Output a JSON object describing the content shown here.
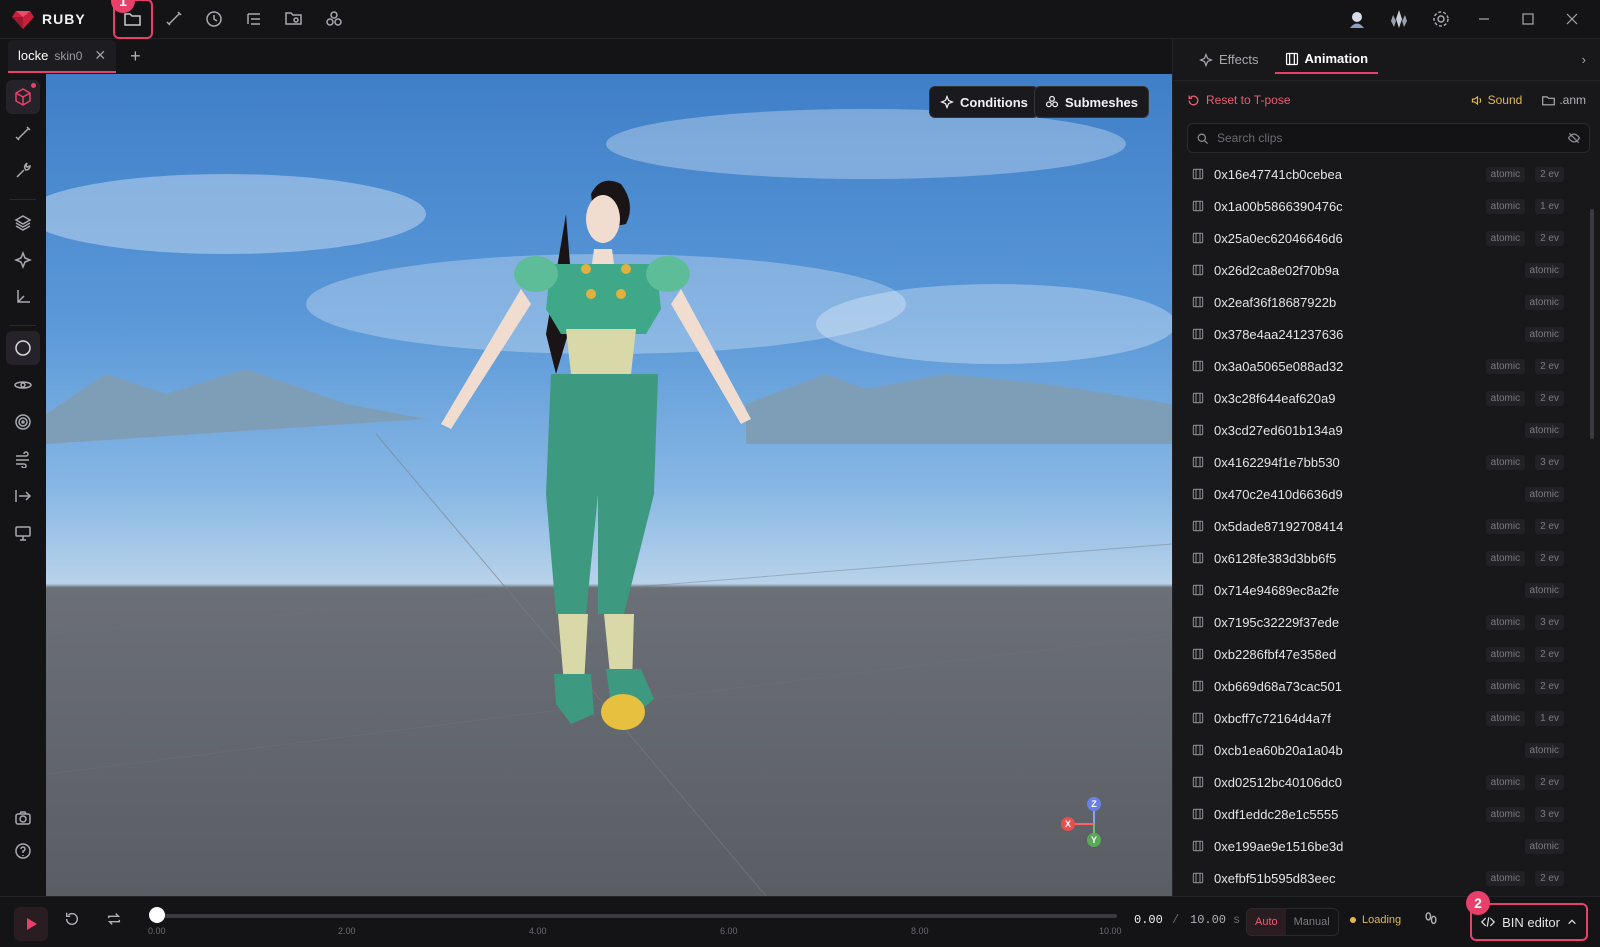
{
  "app": {
    "name": "RUBY"
  },
  "annotations": {
    "marker_1": "1",
    "marker_2": "2"
  },
  "tab": {
    "name": "locke",
    "sub": "skin0"
  },
  "viewport": {
    "conditions_label": "Conditions",
    "submeshes_label": "Submeshes",
    "axis": {
      "x": "X",
      "y": "Y",
      "z": "Z"
    }
  },
  "right_panel": {
    "tabs": [
      {
        "label": "Effects"
      },
      {
        "label": "Animation"
      }
    ],
    "reset_label": "Reset to T-pose",
    "sound_label": "Sound",
    "anm_label": ".anm",
    "search_placeholder": "Search clips",
    "clips": [
      {
        "name": "0x16e47741cb0cebea",
        "tag": "atomic",
        "events": "2 ev"
      },
      {
        "name": "0x1a00b5866390476c",
        "tag": "atomic",
        "events": "1 ev"
      },
      {
        "name": "0x25a0ec62046646d6",
        "tag": "atomic",
        "events": "2 ev"
      },
      {
        "name": "0x26d2ca8e02f70b9a",
        "tag": "atomic",
        "events": ""
      },
      {
        "name": "0x2eaf36f18687922b",
        "tag": "atomic",
        "events": ""
      },
      {
        "name": "0x378e4aa241237636",
        "tag": "atomic",
        "events": ""
      },
      {
        "name": "0x3a0a5065e088ad32",
        "tag": "atomic",
        "events": "2 ev"
      },
      {
        "name": "0x3c28f644eaf620a9",
        "tag": "atomic",
        "events": "2 ev"
      },
      {
        "name": "0x3cd27ed601b134a9",
        "tag": "atomic",
        "events": ""
      },
      {
        "name": "0x4162294f1e7bb530",
        "tag": "atomic",
        "events": "3 ev"
      },
      {
        "name": "0x470c2e410d6636d9",
        "tag": "atomic",
        "events": ""
      },
      {
        "name": "0x5dade87192708414",
        "tag": "atomic",
        "events": "2 ev"
      },
      {
        "name": "0x6128fe383d3bb6f5",
        "tag": "atomic",
        "events": "2 ev"
      },
      {
        "name": "0x714e94689ec8a2fe",
        "tag": "atomic",
        "events": ""
      },
      {
        "name": "0x7195c32229f37ede",
        "tag": "atomic",
        "events": "3 ev"
      },
      {
        "name": "0xb2286fbf47e358ed",
        "tag": "atomic",
        "events": "2 ev"
      },
      {
        "name": "0xb669d68a73cac501",
        "tag": "atomic",
        "events": "2 ev"
      },
      {
        "name": "0xbcff7c72164d4a7f",
        "tag": "atomic",
        "events": "1 ev"
      },
      {
        "name": "0xcb1ea60b20a1a04b",
        "tag": "atomic",
        "events": ""
      },
      {
        "name": "0xd02512bc40106dc0",
        "tag": "atomic",
        "events": "2 ev"
      },
      {
        "name": "0xdf1eddc28e1c5555",
        "tag": "atomic",
        "events": "3 ev"
      },
      {
        "name": "0xe199ae9e1516be3d",
        "tag": "atomic",
        "events": ""
      },
      {
        "name": "0xefbf51b595d83eec",
        "tag": "atomic",
        "events": "2 ev"
      }
    ]
  },
  "timeline": {
    "ticks": [
      "0.00",
      "2.00",
      "4.00",
      "6.00",
      "8.00",
      "10.00"
    ],
    "current_time": "0.00",
    "separator": "/",
    "total_time": "10.00",
    "unit": "s",
    "playhead_fraction": 0,
    "mode_auto": "Auto",
    "mode_manual": "Manual",
    "status": "Loading",
    "bin_editor_label": "BIN editor"
  },
  "colors": {
    "accent": "#e8406a",
    "warning": "#e0b850"
  }
}
